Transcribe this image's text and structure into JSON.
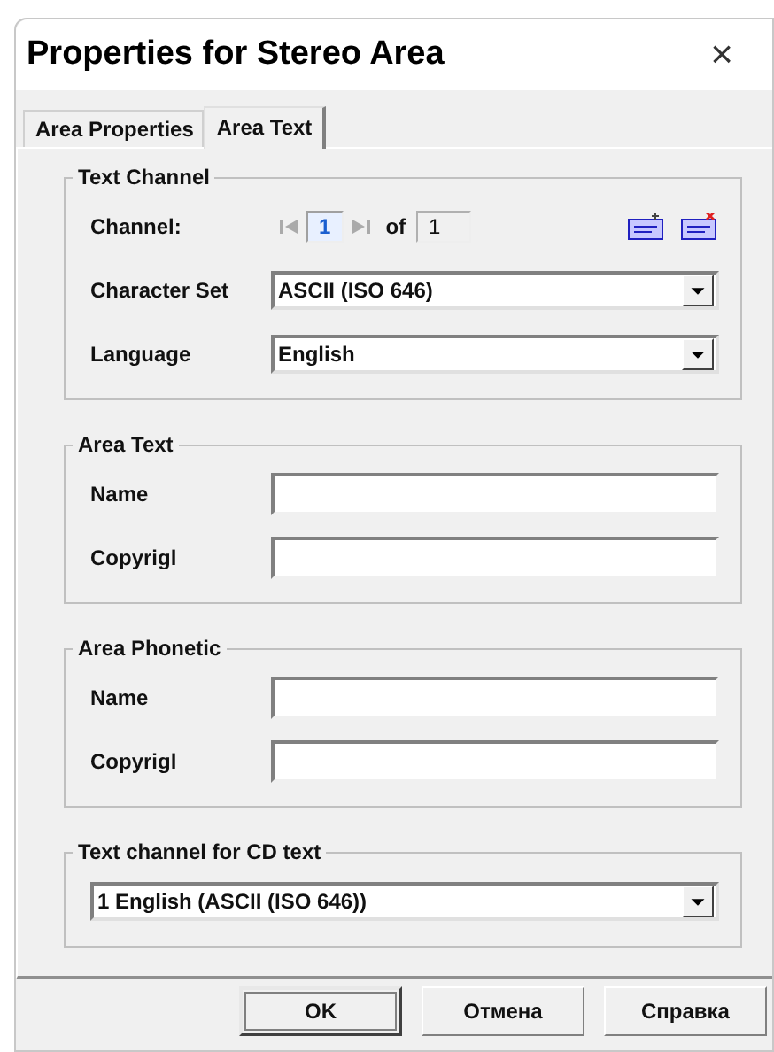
{
  "window": {
    "title": "Properties for Stereo Area",
    "close": "×"
  },
  "tabs": [
    {
      "label": "Area Properties",
      "selected": false
    },
    {
      "label": "Area Text",
      "selected": true
    }
  ],
  "groups": [
    {
      "title": "Text Channel",
      "rows": [
        {
          "kind": "navigator",
          "label": "Channel:",
          "value": "1",
          "value_selected": true,
          "of": "of",
          "total": "1"
        },
        {
          "kind": "combo",
          "label": "Character Set",
          "value": "ASCII (ISO 646)"
        },
        {
          "kind": "combo",
          "label": "Language",
          "value": "English"
        }
      ]
    },
    {
      "title": "Area Text",
      "rows": [
        {
          "kind": "text",
          "label": "Name"
        },
        {
          "kind": "text",
          "label": "Copyrigl"
        }
      ]
    },
    {
      "title": "Area Phonetic",
      "rows": [
        {
          "kind": "text",
          "label": "Name"
        },
        {
          "kind": "text",
          "label": "Copyrigl"
        }
      ]
    },
    {
      "title": "Text channel for CD text",
      "rows": [
        {
          "kind": "combo_full",
          "value": "1 English (ASCII (ISO 646))"
        }
      ]
    }
  ],
  "buttons": [
    {
      "label": "OK",
      "default": true
    },
    {
      "label": "Отмена",
      "default": false
    },
    {
      "label": "Справка",
      "default": false
    }
  ]
}
